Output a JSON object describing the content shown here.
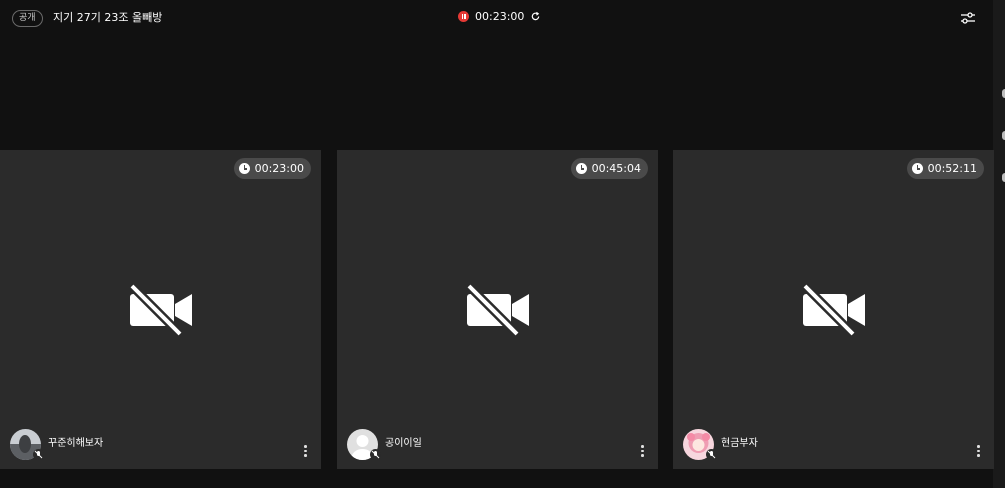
{
  "header": {
    "visibility_badge": "공개",
    "room_title": "지기 27기 23조 올빼방",
    "recording_time": "00:23:00"
  },
  "participants": [
    {
      "name": "꾸준히해보자",
      "timer": "00:23:00",
      "avatar": "photo",
      "avatar_color": "#7a7f86"
    },
    {
      "name": "공이이일",
      "timer": "00:45:04",
      "avatar": "default-user",
      "avatar_color": "#d9d9d9"
    },
    {
      "name": "현금부자",
      "timer": "00:52:11",
      "avatar": "pink-character",
      "avatar_color": "#f2b6c6"
    }
  ],
  "colors": {
    "background": "#111111",
    "tile": "#2b2b2b",
    "record": "#e53935",
    "timer_pill": "#4a4a4a"
  }
}
